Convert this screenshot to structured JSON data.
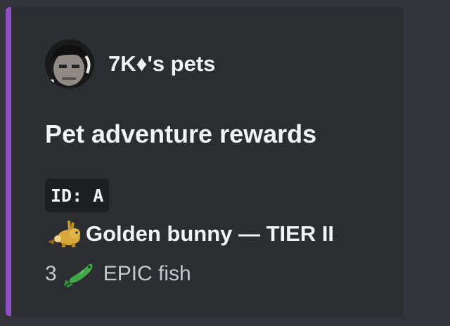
{
  "embed": {
    "accent_color": "#8e4fc7",
    "author": {
      "name": "7K♦'s pets",
      "avatar_icon": "user-avatar"
    },
    "title": "Pet adventure rewards",
    "code_badge": "ID: A",
    "pet_line": {
      "icon": "golden-bunny-icon",
      "text": "Golden bunny — TIER II"
    },
    "reward_line": {
      "count": "3",
      "icon": "fish-icon",
      "text": "EPIC fish"
    }
  }
}
